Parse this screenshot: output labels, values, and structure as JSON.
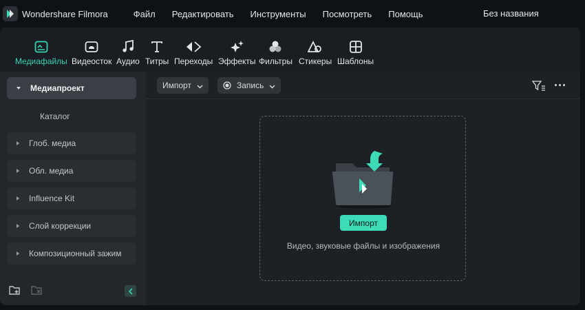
{
  "app": {
    "name": "Wondershare Filmora",
    "project_title": "Без названия"
  },
  "menu": [
    "Файл",
    "Редактировать",
    "Инструменты",
    "Посмотреть",
    "Помощь"
  ],
  "toolbar": {
    "tools": [
      {
        "label": "Медиафайлы",
        "icon": "media-icon",
        "active": true
      },
      {
        "label": "Видеосток",
        "icon": "cloud-stock-icon"
      },
      {
        "label": "Аудио",
        "icon": "music-note-icon"
      },
      {
        "label": "Титры",
        "icon": "text-icon"
      },
      {
        "label": "Переходы",
        "icon": "transition-icon"
      },
      {
        "label": "Эффекты",
        "icon": "effects-sparkle-icon"
      },
      {
        "label": "Фильтры",
        "icon": "filters-icon"
      },
      {
        "label": "Стикеры",
        "icon": "stickers-icon"
      },
      {
        "label": "Шаблоны",
        "icon": "templates-icon"
      }
    ],
    "accent": "#37d3b6"
  },
  "sidebar": {
    "project": "Медиапроект",
    "catalog": "Каталог",
    "items": [
      "Глоб. медиа",
      "Обл. медиа",
      "Influence Kit",
      "Слой коррекции",
      "Композиционный зажим"
    ],
    "bottom_icons": [
      "new-folder-icon",
      "delete-folder-icon",
      "collapse-left-icon"
    ]
  },
  "content": {
    "import_dropdown": "Импорт",
    "record_dropdown": "Запись",
    "import_button": "Импорт",
    "hint": "Видео, звуковые файлы и изображения"
  }
}
